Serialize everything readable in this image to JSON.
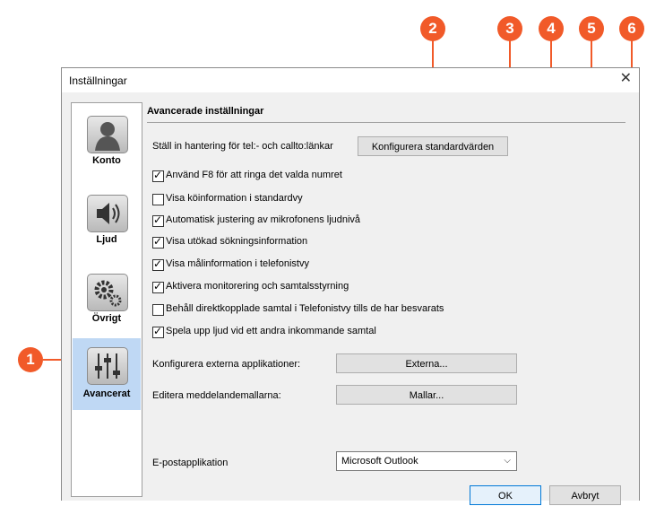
{
  "window": {
    "title": "Inställningar",
    "close_icon": "close-icon"
  },
  "sidebar": {
    "items": [
      {
        "label": "Konto",
        "icon": "person-icon",
        "active": false
      },
      {
        "label": "Ljud",
        "icon": "speaker-icon",
        "active": false
      },
      {
        "label": "Övrigt",
        "icon": "gears-icon",
        "active": false
      },
      {
        "label": "Avancerat",
        "icon": "sliders-icon",
        "active": true
      }
    ]
  },
  "main": {
    "section_title": "Avancerade inställningar",
    "tel_label": "Ställ in hantering för tel:- och callto:länkar",
    "tel_button": "Konfigurera standardvärden",
    "options": [
      {
        "label": "Använd F8 för att ringa det valda numret",
        "checked": true
      },
      {
        "label": "Visa köinformation i standardvy",
        "checked": false
      },
      {
        "label": "Automatisk justering av mikrofonens ljudnivå",
        "checked": true
      },
      {
        "label": "Visa utökad sökningsinformation",
        "checked": true
      },
      {
        "label": "Visa målinformation i telefonistvy",
        "checked": true
      },
      {
        "label": "Aktivera monitorering och samtalsstyrning",
        "checked": true
      },
      {
        "label": "Behåll direktkopplade samtal i Telefonistvy tills de har besvarats",
        "checked": false
      },
      {
        "label": "Spela upp ljud vid ett andra inkommande samtal",
        "checked": true
      }
    ],
    "external_label": "Konfigurera externa applikationer:",
    "external_button": "Externa...",
    "templates_label": "Editera meddelandemallarna:",
    "templates_button": "Mallar...",
    "email_label": "E-postapplikation",
    "email_value": "Microsoft Outlook"
  },
  "footer": {
    "ok": "OK",
    "cancel": "Avbryt"
  },
  "callouts": [
    "1",
    "2",
    "3",
    "4",
    "5",
    "6"
  ],
  "colors": {
    "callout": "#f15a29",
    "active_nav": "#bfd8f4"
  }
}
